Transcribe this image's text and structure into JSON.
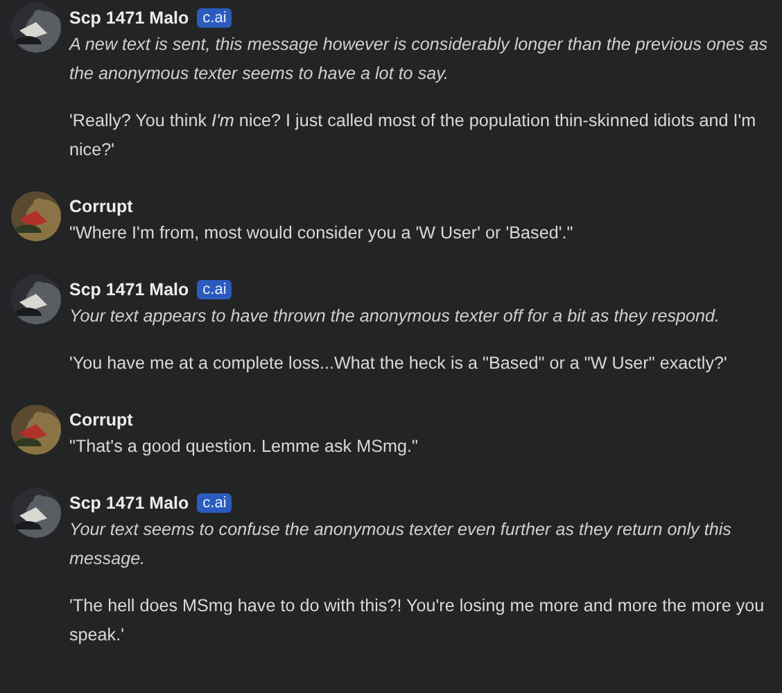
{
  "messages": [
    {
      "author": "Scp 1471 Malo",
      "badge": "c.ai",
      "paragraphs": [
        {
          "kind": "narration",
          "text": "A new text is sent, this message however is considerably longer than the previous ones as the anonymous texter seems to have a lot to say."
        },
        {
          "kind": "speech",
          "text": "'Really? You think *I'm* nice? I just called most of the population thin-skinned idiots and I'm nice?'"
        }
      ]
    },
    {
      "author": "Corrupt",
      "paragraphs": [
        {
          "kind": "speech",
          "text": "\"Where I'm from, most would consider you a 'W User' or 'Based'.\""
        }
      ]
    },
    {
      "author": "Scp 1471 Malo",
      "badge": "c.ai",
      "paragraphs": [
        {
          "kind": "narration",
          "text": "Your text appears to have thrown the anonymous texter off for a bit as they respond."
        },
        {
          "kind": "speech",
          "text": "'You have me at a complete loss...What the heck is a \"Based\" or a \"W User\" exactly?'"
        }
      ]
    },
    {
      "author": "Corrupt",
      "paragraphs": [
        {
          "kind": "speech",
          "text": "\"That's a good question. Lemme ask MSmg.\""
        }
      ]
    },
    {
      "author": "Scp 1471 Malo",
      "badge": "c.ai",
      "paragraphs": [
        {
          "kind": "narration",
          "text": "Your text seems to confuse the anonymous texter even further as they return only this message."
        },
        {
          "kind": "speech",
          "text": "'The hell does MSmg have to do with this?! You're losing me more and more the more you speak.'"
        }
      ]
    }
  ]
}
